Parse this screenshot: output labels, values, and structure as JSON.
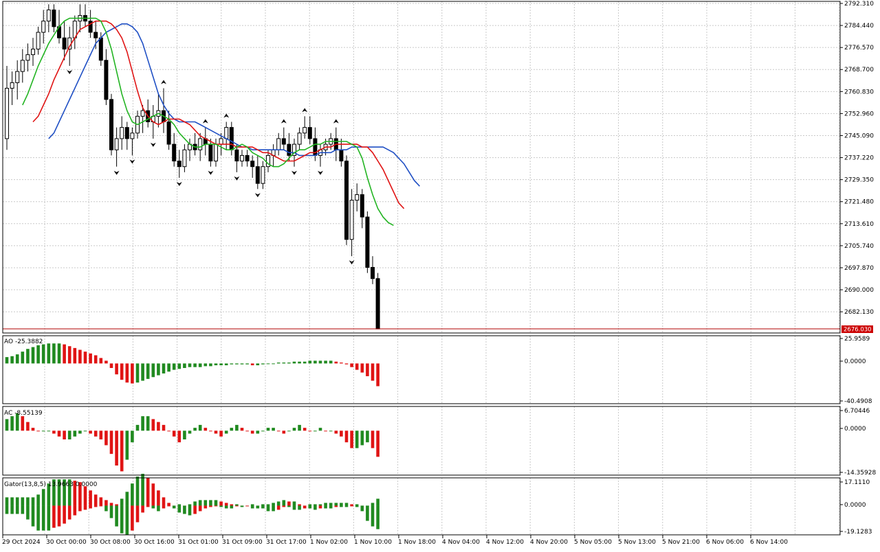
{
  "colors": {
    "background": "#ffffff",
    "grid": "#c8c8c8",
    "frame": "#000000",
    "bull_body": "#ffffff",
    "bear_body": "#000000",
    "jaw": "#1f4fc4",
    "teeth": "#e01414",
    "lips": "#22b422",
    "up_bar": "#208a20",
    "down_bar": "#e01414",
    "price_line": "#b00000",
    "price_box": "#cc0000"
  },
  "panels": {
    "main": {
      "current_price": "2676.030",
      "y_labels": [
        "2792.310",
        "2784.440",
        "2776.570",
        "2768.700",
        "2760.830",
        "2752.960",
        "2745.090",
        "2737.220",
        "2729.350",
        "2721.480",
        "2713.610",
        "2705.740",
        "2697.870",
        "2690.000",
        "2682.130"
      ]
    },
    "ao": {
      "label": "AO -25.3882",
      "y_labels": [
        "25.9589",
        "0.0000",
        "-40.4908"
      ]
    },
    "ac": {
      "label": "AC -8.55139",
      "y_labels": [
        "6.70446",
        "0.0000",
        "-14.35928"
      ]
    },
    "gator": {
      "label": "Gator(13,8,5) 13.9663 0.0000",
      "y_labels": [
        "17.1110",
        "0.0000",
        "-19.1283"
      ]
    }
  },
  "time_axis": [
    "29 Oct 2024",
    "30 Oct 00:00",
    "30 Oct 08:00",
    "30 Oct 16:00",
    "31 Oct 01:00",
    "31 Oct 09:00",
    "31 Oct 17:00",
    "1 Nov 02:00",
    "1 Nov 10:00",
    "1 Nov 18:00",
    "4 Nov 04:00",
    "4 Nov 12:00",
    "4 Nov 20:00",
    "5 Nov 05:00",
    "5 Nov 13:00",
    "5 Nov 21:00",
    "6 Nov 06:00",
    "6 Nov 14:00"
  ],
  "chart_data": {
    "type": "candlestick",
    "ylim": [
      2676.03,
      2792.31
    ],
    "candles": [
      [
        2744,
        2770,
        2740,
        2762
      ],
      [
        2762,
        2768,
        2756,
        2764
      ],
      [
        2764,
        2772,
        2758,
        2768
      ],
      [
        2768,
        2776,
        2764,
        2772
      ],
      [
        2772,
        2778,
        2768,
        2774
      ],
      [
        2774,
        2780,
        2770,
        2776
      ],
      [
        2776,
        2784,
        2774,
        2782
      ],
      [
        2782,
        2790,
        2778,
        2786
      ],
      [
        2786,
        2792,
        2782,
        2790
      ],
      [
        2790,
        2792,
        2782,
        2784
      ],
      [
        2784,
        2790,
        2778,
        2780
      ],
      [
        2780,
        2786,
        2772,
        2776
      ],
      [
        2776,
        2784,
        2770,
        2780
      ],
      [
        2780,
        2788,
        2776,
        2786
      ],
      [
        2786,
        2792,
        2782,
        2788
      ],
      [
        2788,
        2792,
        2784,
        2786
      ],
      [
        2786,
        2790,
        2780,
        2782
      ],
      [
        2782,
        2786,
        2776,
        2780
      ],
      [
        2780,
        2782,
        2770,
        2772
      ],
      [
        2772,
        2776,
        2756,
        2758
      ],
      [
        2758,
        2760,
        2738,
        2740
      ],
      [
        2740,
        2748,
        2734,
        2744
      ],
      [
        2744,
        2752,
        2740,
        2748
      ],
      [
        2748,
        2750,
        2740,
        2744
      ],
      [
        2744,
        2748,
        2738,
        2746
      ],
      [
        2746,
        2754,
        2744,
        2752
      ],
      [
        2752,
        2756,
        2746,
        2754
      ],
      [
        2754,
        2758,
        2748,
        2750
      ],
      [
        2750,
        2756,
        2744,
        2752
      ],
      [
        2752,
        2760,
        2748,
        2754
      ],
      [
        2754,
        2762,
        2746,
        2750
      ],
      [
        2750,
        2754,
        2740,
        2742
      ],
      [
        2742,
        2746,
        2734,
        2736
      ],
      [
        2736,
        2740,
        2730,
        2734
      ],
      [
        2734,
        2742,
        2732,
        2740
      ],
      [
        2740,
        2744,
        2736,
        2742
      ],
      [
        2742,
        2746,
        2738,
        2740
      ],
      [
        2740,
        2746,
        2736,
        2744
      ],
      [
        2744,
        2748,
        2738,
        2742
      ],
      [
        2742,
        2744,
        2734,
        2736
      ],
      [
        2736,
        2744,
        2734,
        2742
      ],
      [
        2742,
        2746,
        2738,
        2744
      ],
      [
        2744,
        2750,
        2740,
        2748
      ],
      [
        2748,
        2750,
        2738,
        2740
      ],
      [
        2740,
        2742,
        2732,
        2736
      ],
      [
        2736,
        2740,
        2734,
        2738
      ],
      [
        2738,
        2740,
        2734,
        2736
      ],
      [
        2736,
        2738,
        2730,
        2734
      ],
      [
        2734,
        2738,
        2726,
        2728
      ],
      [
        2728,
        2736,
        2726,
        2734
      ],
      [
        2734,
        2740,
        2732,
        2738
      ],
      [
        2738,
        2742,
        2734,
        2740
      ],
      [
        2740,
        2746,
        2738,
        2744
      ],
      [
        2744,
        2748,
        2740,
        2742
      ],
      [
        2742,
        2746,
        2736,
        2738
      ],
      [
        2738,
        2744,
        2734,
        2742
      ],
      [
        2742,
        2748,
        2740,
        2746
      ],
      [
        2746,
        2752,
        2744,
        2748
      ],
      [
        2748,
        2752,
        2742,
        2744
      ],
      [
        2744,
        2748,
        2736,
        2738
      ],
      [
        2738,
        2742,
        2734,
        2740
      ],
      [
        2740,
        2744,
        2738,
        2742
      ],
      [
        2742,
        2746,
        2740,
        2744
      ],
      [
        2744,
        2748,
        2736,
        2740
      ],
      [
        2740,
        2744,
        2734,
        2736
      ],
      [
        2736,
        2738,
        2706,
        2708
      ],
      [
        2708,
        2726,
        2702,
        2722
      ],
      [
        2722,
        2728,
        2718,
        2724
      ],
      [
        2724,
        2726,
        2712,
        2716
      ],
      [
        2716,
        2718,
        2696,
        2698
      ],
      [
        2698,
        2702,
        2692,
        2694
      ],
      [
        2694,
        2696,
        2676,
        2676
      ]
    ],
    "jaw": [
      2744,
      2746,
      2750,
      2754,
      2758,
      2762,
      2766,
      2770,
      2774,
      2778,
      2780,
      2782,
      2783,
      2784,
      2785,
      2785,
      2784,
      2782,
      2778,
      2772,
      2766,
      2760,
      2756,
      2753,
      2751,
      2750,
      2750,
      2750,
      2750,
      2749,
      2748,
      2747,
      2746,
      2745,
      2744,
      2743,
      2742,
      2741,
      2741,
      2740,
      2740,
      2740,
      2740,
      2740,
      2740,
      2740,
      2739,
      2739,
      2738,
      2738,
      2738,
      2738,
      2739,
      2739,
      2739,
      2740,
      2740,
      2740,
      2741,
      2741,
      2741,
      2741,
      2741,
      2741,
      2741,
      2740,
      2739,
      2737,
      2735,
      2732,
      2729,
      2727
    ],
    "teeth": [
      2750,
      2752,
      2756,
      2760,
      2765,
      2769,
      2773,
      2777,
      2780,
      2783,
      2784,
      2785,
      2786,
      2786,
      2786,
      2785,
      2783,
      2780,
      2775,
      2768,
      2761,
      2755,
      2752,
      2750,
      2749,
      2750,
      2751,
      2751,
      2751,
      2750,
      2749,
      2747,
      2745,
      2744,
      2743,
      2742,
      2742,
      2742,
      2742,
      2741,
      2741,
      2741,
      2741,
      2740,
      2739,
      2739,
      2738,
      2737,
      2736,
      2736,
      2736,
      2737,
      2738,
      2739,
      2739,
      2740,
      2741,
      2741,
      2742,
      2742,
      2742,
      2742,
      2742,
      2741,
      2741,
      2739,
      2736,
      2733,
      2729,
      2725,
      2721,
      2719
    ],
    "lips": [
      2756,
      2760,
      2765,
      2770,
      2774,
      2778,
      2781,
      2784,
      2786,
      2787,
      2787,
      2787,
      2787,
      2787,
      2787,
      2786,
      2782,
      2776,
      2768,
      2760,
      2754,
      2750,
      2749,
      2750,
      2751,
      2752,
      2753,
      2752,
      2751,
      2749,
      2746,
      2744,
      2742,
      2741,
      2741,
      2742,
      2742,
      2742,
      2741,
      2740,
      2740,
      2741,
      2742,
      2741,
      2739,
      2738,
      2737,
      2735,
      2734,
      2734,
      2735,
      2737,
      2739,
      2740,
      2740,
      2741,
      2742,
      2742,
      2743,
      2743,
      2743,
      2743,
      2743,
      2742,
      2741,
      2737,
      2730,
      2724,
      2719,
      2716,
      2714,
      2713
    ],
    "ao": [
      7,
      8,
      10,
      13,
      16,
      18,
      20,
      21,
      22,
      22,
      22,
      21,
      19,
      17,
      15,
      13,
      11,
      9,
      6,
      3,
      -5,
      -12,
      -18,
      -21,
      -22,
      -21,
      -19,
      -17,
      -15,
      -13,
      -11,
      -9,
      -7,
      -6,
      -5,
      -4,
      -4,
      -4,
      -3,
      -3,
      -2,
      -2,
      -2,
      -1,
      -1,
      -1,
      -1,
      -2,
      -2,
      -1,
      0,
      0,
      1,
      1,
      1,
      2,
      2,
      2,
      3,
      3,
      3,
      3,
      3,
      2,
      1,
      -1,
      -4,
      -7,
      -10,
      -14,
      -19,
      -25
    ],
    "ac": [
      4,
      5,
      6,
      5,
      3,
      1,
      0,
      0,
      0,
      -1,
      -2,
      -3,
      -3,
      -2,
      -1,
      0,
      -1,
      -2,
      -3,
      -5,
      -8,
      -12,
      -14,
      -10,
      -4,
      2,
      5,
      5,
      4,
      3,
      2,
      0,
      -2,
      -4,
      -3,
      -1,
      1,
      2,
      1,
      0,
      -1,
      -2,
      -1,
      1,
      2,
      1,
      0,
      -1,
      -1,
      0,
      1,
      1,
      0,
      -1,
      0,
      1,
      2,
      1,
      0,
      0,
      1,
      0,
      0,
      -1,
      -2,
      -4,
      -6,
      -6,
      -5,
      -4,
      -6,
      -9
    ]
  }
}
